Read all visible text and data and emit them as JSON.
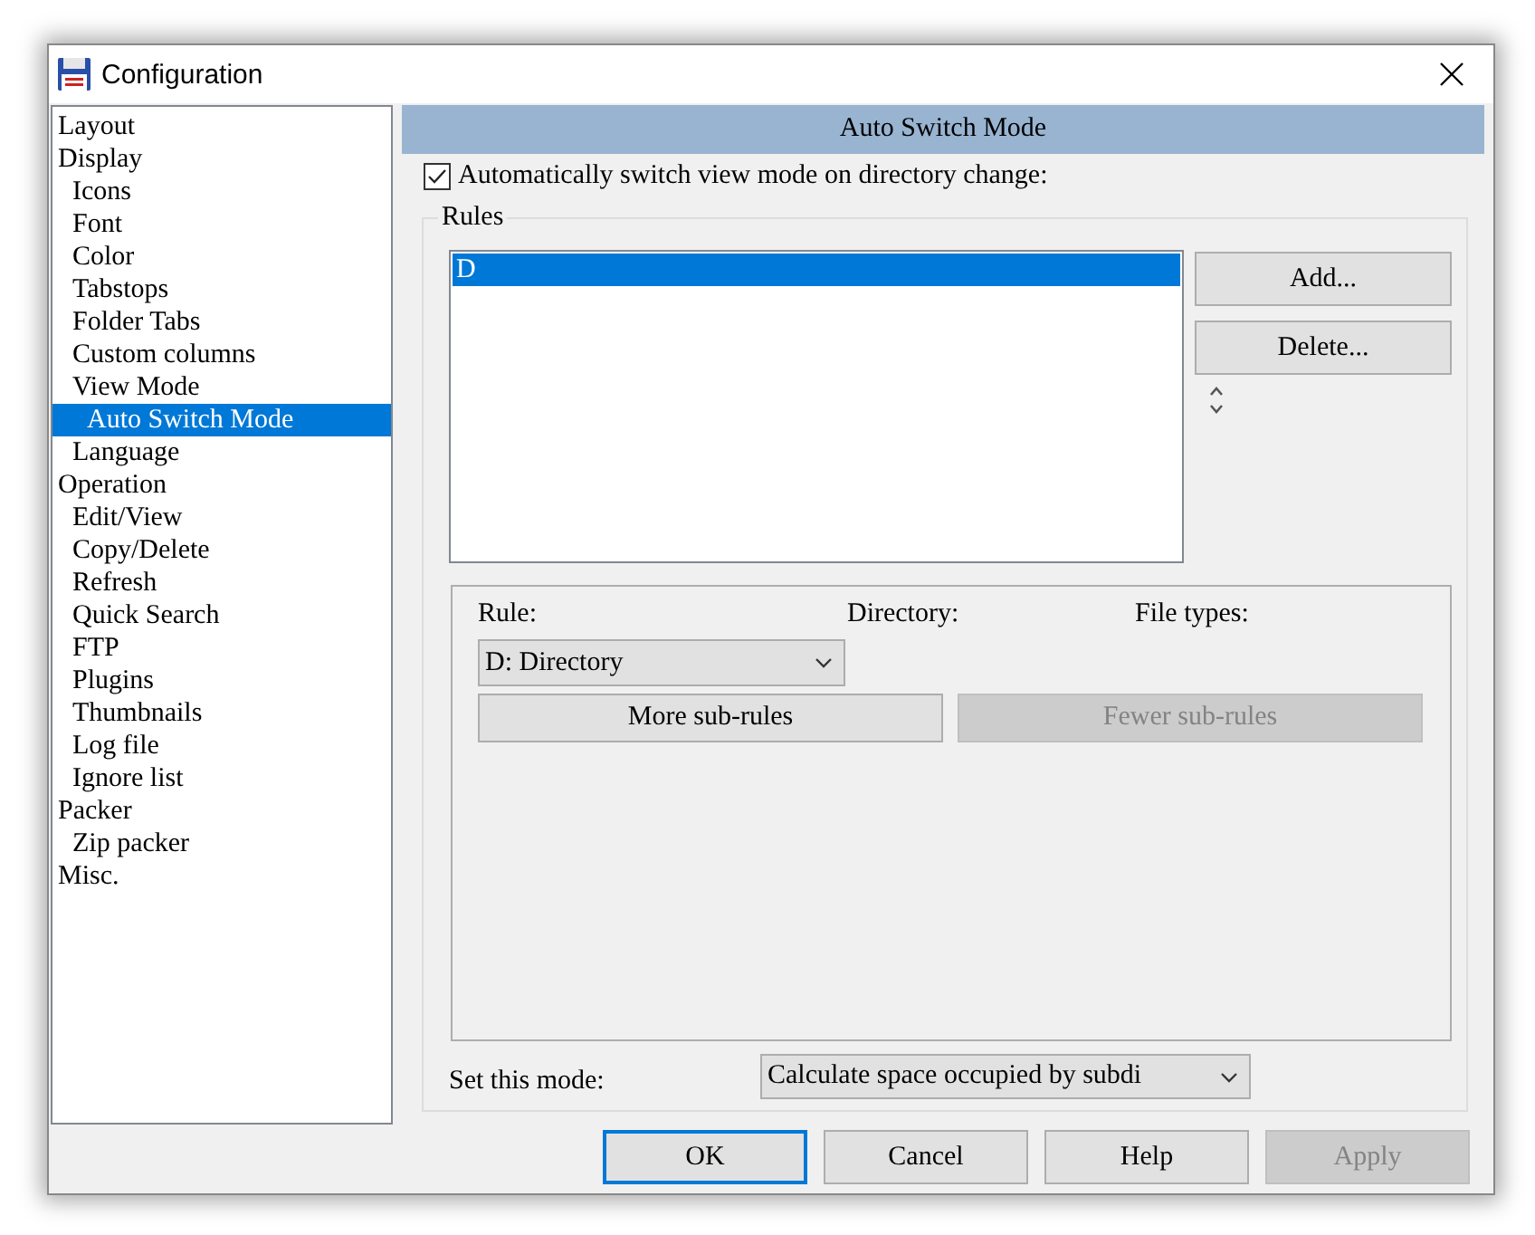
{
  "window": {
    "title": "Configuration"
  },
  "sidebar": {
    "items": [
      {
        "label": "Layout",
        "selected": false
      },
      {
        "label": "Display",
        "selected": false,
        "children": [
          {
            "label": "Icons",
            "selected": false
          },
          {
            "label": "Font",
            "selected": false
          },
          {
            "label": "Color",
            "selected": false
          },
          {
            "label": "Tabstops",
            "selected": false
          },
          {
            "label": "Folder Tabs",
            "selected": false
          },
          {
            "label": "Custom columns",
            "selected": false
          },
          {
            "label": "View Mode",
            "selected": false,
            "children": [
              {
                "label": "Auto Switch Mode",
                "selected": true
              }
            ]
          },
          {
            "label": "Language",
            "selected": false
          }
        ]
      },
      {
        "label": "Operation",
        "selected": false,
        "children": [
          {
            "label": "Edit/View",
            "selected": false
          },
          {
            "label": "Copy/Delete",
            "selected": false
          },
          {
            "label": "Refresh",
            "selected": false
          },
          {
            "label": "Quick Search",
            "selected": false
          },
          {
            "label": "FTP",
            "selected": false
          },
          {
            "label": "Plugins",
            "selected": false
          },
          {
            "label": "Thumbnails",
            "selected": false
          },
          {
            "label": "Log file",
            "selected": false
          },
          {
            "label": "Ignore list",
            "selected": false
          }
        ]
      },
      {
        "label": "Packer",
        "selected": false,
        "children": [
          {
            "label": "Zip packer",
            "selected": false
          }
        ]
      },
      {
        "label": "Misc.",
        "selected": false
      }
    ]
  },
  "panel": {
    "title": "Auto Switch Mode",
    "auto_switch": {
      "label": "Automatically switch view mode on directory change:",
      "checked": true
    },
    "rules": {
      "title": "Rules",
      "list": [
        {
          "label": "D",
          "selected": true
        }
      ],
      "buttons": [
        {
          "label": "Add...",
          "disabled": false
        },
        {
          "label": "Delete...",
          "disabled": false
        }
      ],
      "sub_rules": {
        "columns": [
          "Rule:",
          "Directory:",
          "File types:"
        ],
        "rule_select": {
          "value": "D: Directory"
        },
        "buttons": [
          {
            "label": "More sub-rules",
            "disabled": false
          },
          {
            "label": "Fewer sub-rules",
            "disabled": true
          }
        ]
      },
      "mode": {
        "label": "Set this mode:",
        "value": "Calculate space occupied by subdi"
      }
    }
  },
  "buttons": [
    {
      "label": "OK",
      "disabled": false,
      "focused": true
    },
    {
      "label": "Cancel",
      "disabled": false,
      "focused": false
    },
    {
      "label": "Help",
      "disabled": false,
      "focused": false
    },
    {
      "label": "Apply",
      "disabled": true,
      "focused": false
    }
  ]
}
